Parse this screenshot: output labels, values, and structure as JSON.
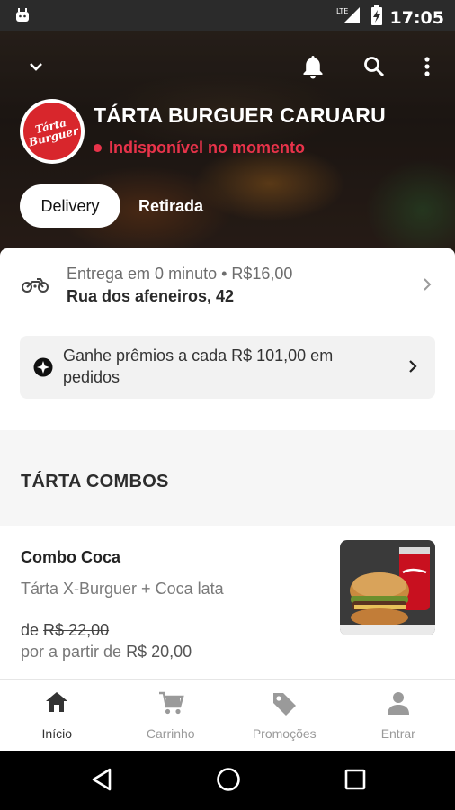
{
  "status_bar": {
    "time": "17:05",
    "network": "LTE"
  },
  "header": {
    "icons": [
      "chevron-down-icon",
      "bell-icon",
      "search-icon",
      "more-vert-icon"
    ],
    "logo_text_line1": "Tárta",
    "logo_text_line2": "Burguer",
    "store_name": "TÁRTA BURGUER CARUARU",
    "store_status": "Indisponível no momento",
    "status_color": "#e8334a"
  },
  "tabs": [
    {
      "label": "Delivery",
      "active": true
    },
    {
      "label": "Retirada",
      "active": false
    }
  ],
  "delivery": {
    "eta_text": "Entrega em 0 minuto • R$16,00",
    "address": "Rua dos afeneiros, 42"
  },
  "rewards": {
    "text": "Ganhe prêmios a cada R$ 101,00 em pedidos"
  },
  "section": {
    "title": "TÁRTA COMBOS"
  },
  "product": {
    "name": "Combo Coca",
    "description": "Tárta X-Burguer + Coca lata",
    "old_prefix": "de",
    "old_price": "R$ 22,00",
    "new_prefix": "por a partir de",
    "new_price": "R$ 20,00"
  },
  "bottom_nav": [
    {
      "label": "Início",
      "icon": "home-icon",
      "active": true
    },
    {
      "label": "Carrinho",
      "icon": "cart-icon",
      "active": false
    },
    {
      "label": "Promoções",
      "icon": "tag-icon",
      "active": false
    },
    {
      "label": "Entrar",
      "icon": "person-icon",
      "active": false
    }
  ],
  "colors": {
    "accent": "#e8334a",
    "brand_red": "#d8262c"
  }
}
